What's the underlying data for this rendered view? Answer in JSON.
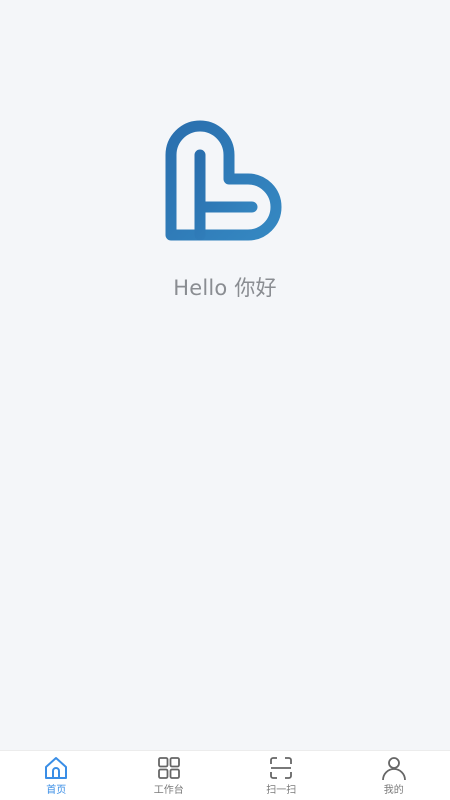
{
  "main": {
    "greeting": "Hello 你好"
  },
  "colors": {
    "brand": "#2f7bb6",
    "active_tab": "#3a8ee6",
    "inactive_tab": "#7a7a7a",
    "background": "#f4f6f9"
  },
  "tabbar": {
    "active_index": 0,
    "tabs": [
      {
        "label": "首页",
        "icon": "home-icon"
      },
      {
        "label": "工作台",
        "icon": "grid-icon"
      },
      {
        "label": "扫一扫",
        "icon": "scan-icon"
      },
      {
        "label": "我的",
        "icon": "user-icon"
      }
    ]
  }
}
